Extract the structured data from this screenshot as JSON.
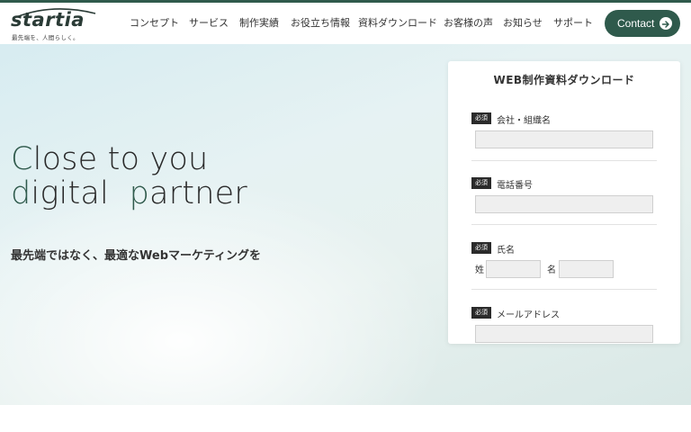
{
  "header": {
    "logo_text": "startia",
    "tagline": "最先端を、人間らしく。",
    "nav": [
      "コンセプト",
      "サービス",
      "制作実績",
      "お役立ち情報",
      "資料ダウンロード",
      "お客様の声",
      "お知らせ",
      "サポート"
    ],
    "contact_label": "Contact"
  },
  "hero": {
    "title_line1_accent": "C",
    "title_line1_rest": "lose to you",
    "title_line2_accent": "d",
    "title_line2_mid": "igital  ",
    "title_line2_accent2": "p",
    "title_line2_rest": "artner",
    "subtitle": "最先端ではなく、最適なWebマーケティングを"
  },
  "form": {
    "title": "WEB制作資料ダウンロード",
    "required_badge": "必須",
    "fields": [
      {
        "label": "会社・組織名"
      },
      {
        "label": "電話番号"
      },
      {
        "label": "氏名",
        "last_name": "姓",
        "first_name": "名"
      },
      {
        "label": "メールアドレス"
      }
    ]
  },
  "colors": {
    "brand": "#2f5a4c",
    "badge": "#2b2b2b"
  }
}
